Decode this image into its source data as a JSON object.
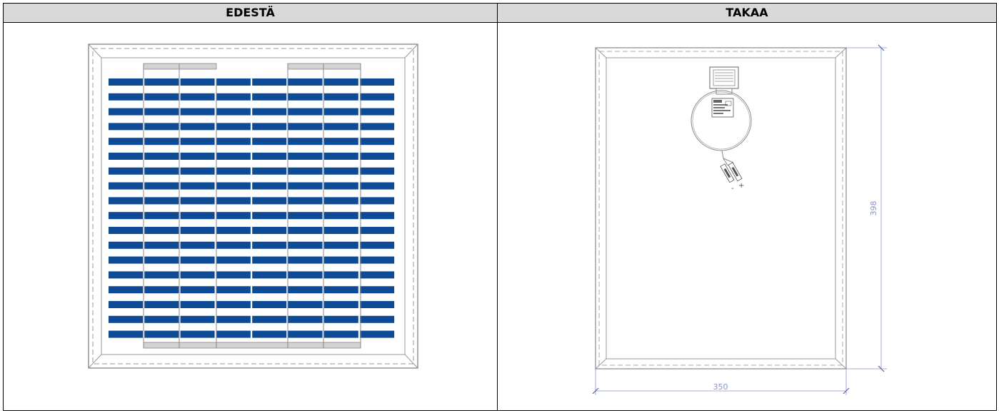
{
  "headers": {
    "front": "EDESTÄ",
    "back": "TAKAA"
  },
  "front_panel": {
    "cell_rows": 18,
    "cell_cols": 8,
    "cell_color": "#0d4b96"
  },
  "back_panel": {
    "dimensions": {
      "height": "398",
      "width": "350"
    },
    "junction_label": "+",
    "junction_minus": "-"
  },
  "colors": {
    "frame": "#8a8a8a",
    "dimension": "#7a86c8",
    "bar": "#d3d3d3"
  }
}
